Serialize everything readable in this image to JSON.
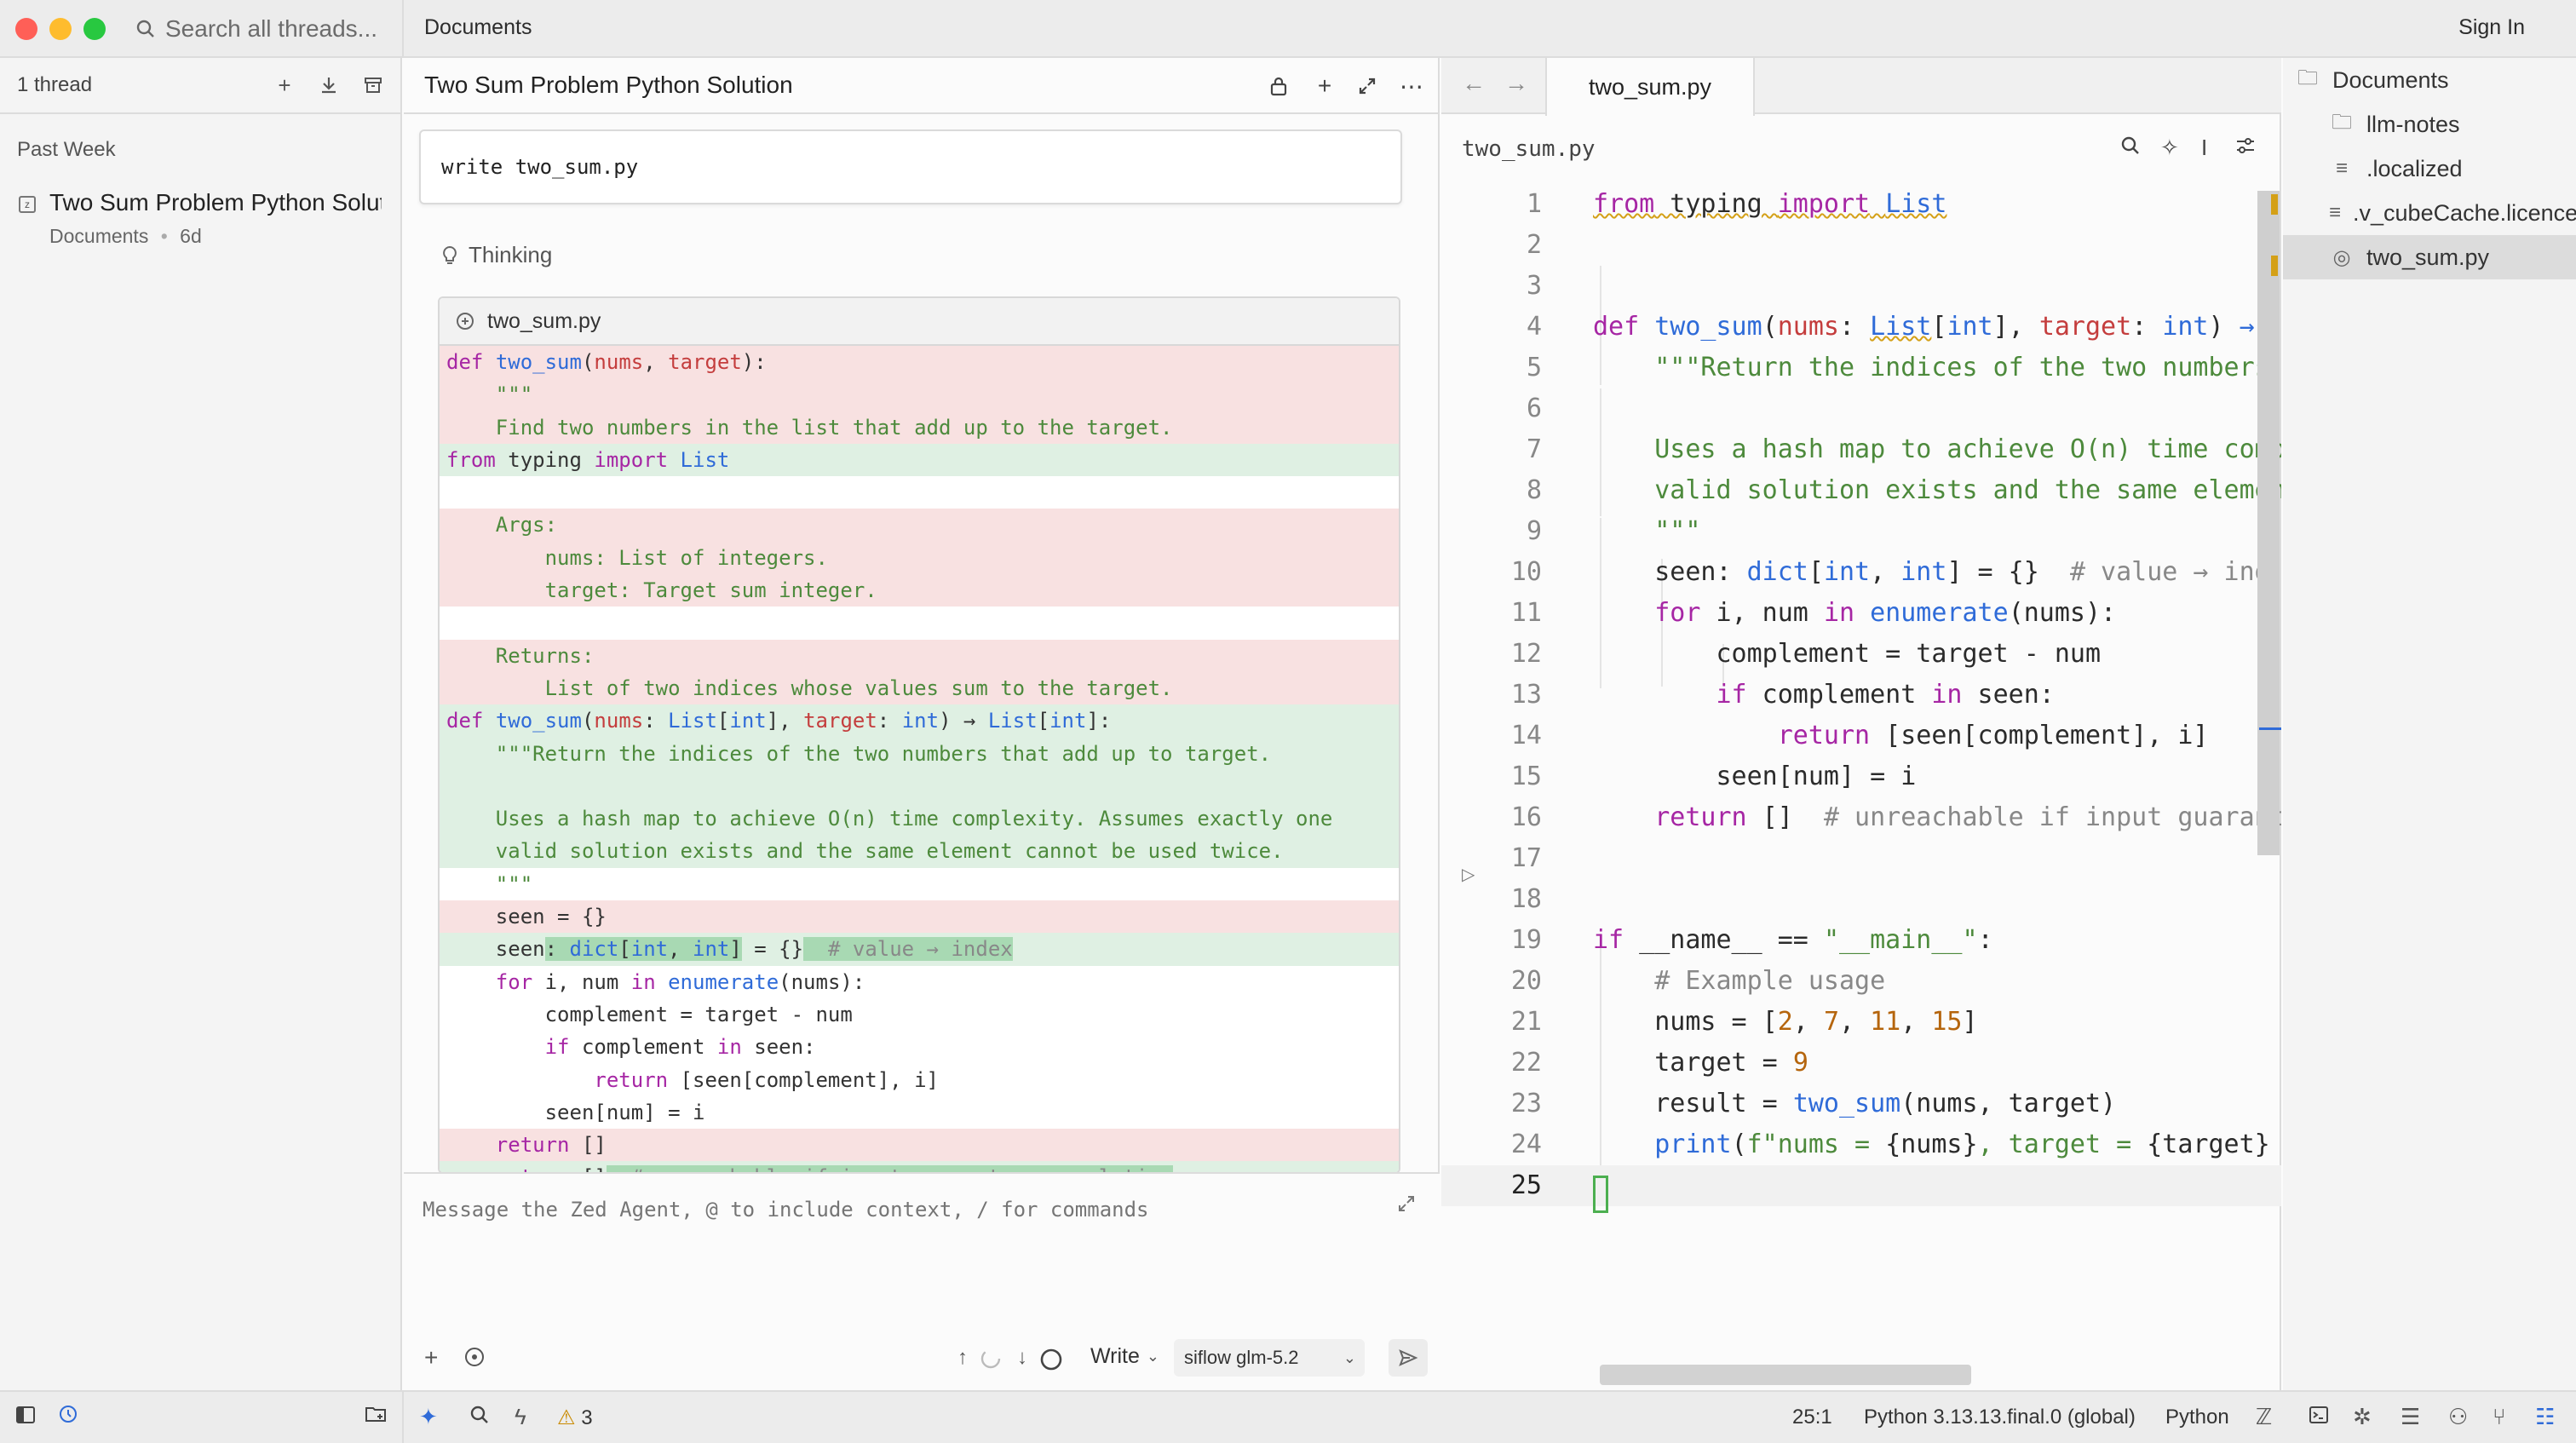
{
  "titlebar": {
    "search_placeholder": "Search all threads...",
    "workspace": "Documents",
    "sign_in": "Sign In"
  },
  "threads": {
    "count_label": "1 thread",
    "section": "Past Week",
    "items": [
      {
        "title": "Two Sum Problem Python Solution",
        "project": "Documents",
        "age": "6d"
      }
    ]
  },
  "agent": {
    "title": "Two Sum Problem Python Solution",
    "user_message": "write two_sum.py",
    "thinking_label": "Thinking",
    "diff_file": "two_sum.py",
    "composer_placeholder": "Message the Zed Agent, @ to include context, / for commands",
    "mode": "Write",
    "model": "siflow glm-5.2"
  },
  "editor": {
    "tab": "two_sum.py",
    "breadcrumb": "two_sum.py",
    "line_numbers": [
      "1",
      "2",
      "3",
      "4",
      "5",
      "6",
      "7",
      "8",
      "9",
      "10",
      "11",
      "12",
      "13",
      "14",
      "15",
      "16",
      "17",
      "18",
      "19",
      "20",
      "21",
      "22",
      "23",
      "24",
      "25"
    ]
  },
  "project": {
    "root": "Documents",
    "items": [
      {
        "name": "llm-notes",
        "icon": "folder-icon"
      },
      {
        "name": ".localized",
        "icon": "file-lines-icon"
      },
      {
        "name": ".v_cubeCache.licence",
        "icon": "file-lines-icon"
      },
      {
        "name": "two_sum.py",
        "icon": "python-file-icon",
        "selected": true
      }
    ]
  },
  "status": {
    "warnings": "3",
    "cursor": "25:1",
    "interpreter": "Python 3.13.13.final.0 (global)",
    "language": "Python"
  }
}
